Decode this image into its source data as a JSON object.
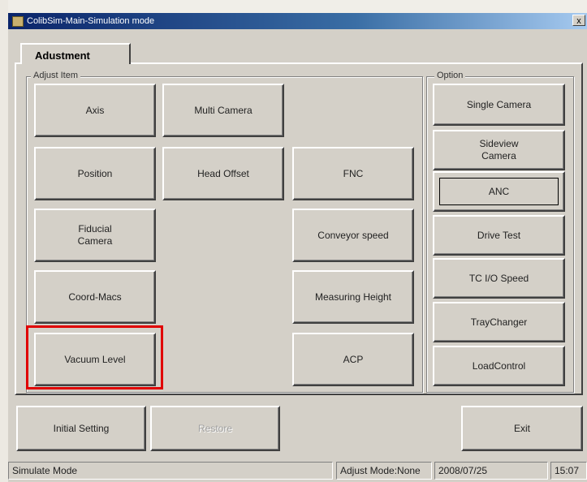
{
  "window": {
    "title": "ColibSim-Main-Simulation mode",
    "close_label": "x"
  },
  "tab": {
    "label": "Adustment"
  },
  "adjust_group": {
    "label": "Adjust Item",
    "buttons": {
      "axis": "Axis",
      "multi_camera": "Multi Camera",
      "position": "Position",
      "head_offset": "Head Offset",
      "fnc": "FNC",
      "fiducial_camera": "Fiducial\nCamera",
      "conveyor_speed": "Conveyor speed",
      "coord_macs": "Coord-Macs",
      "measuring_height": "Measuring Height",
      "vacuum_level": "Vacuum Level",
      "acp": "ACP"
    }
  },
  "option_group": {
    "label": "Option",
    "buttons": {
      "single_camera": "Single Camera",
      "sideview_camera": "Sideview\nCamera",
      "anc": "ANC",
      "drive_test": "Drive Test",
      "tc_io_speed": "TC I/O Speed",
      "tray_changer": "TrayChanger",
      "load_control": "LoadControl"
    }
  },
  "footer": {
    "initial_setting": "Initial Setting",
    "restore": "Restore",
    "exit": "Exit"
  },
  "status": {
    "mode": "Simulate Mode",
    "adjust_mode": "Adjust Mode:None",
    "date": "2008/07/25",
    "time": "15:07"
  },
  "colors": {
    "highlight": "#e00000",
    "titlebar": "#0a246a"
  }
}
